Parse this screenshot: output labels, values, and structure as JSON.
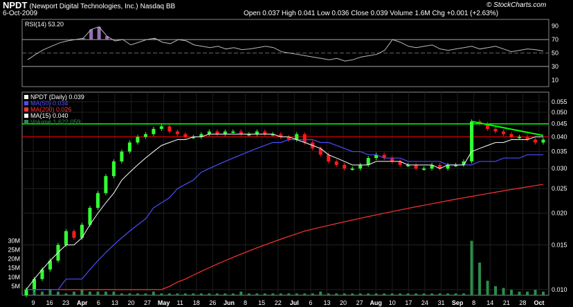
{
  "header": {
    "symbol": "NPDT",
    "company": "(Newport Digital Technologies, Inc.)",
    "exchange": "Nasdaq BB",
    "date": "6-Oct-2009",
    "ohlc": "Open 0.037  High 0.041  Low 0.036  Close 0.039  Volume 1.6M  Chg +0.001 (+2.63%)",
    "brand": "© StockCharts.com"
  },
  "colors": {
    "up": "#33ff33",
    "down": "#ff1a1a",
    "ma50": "#4d4dff",
    "ma200": "#ff3333",
    "ma15": "#ffffff",
    "volume": "#2d8a4e",
    "resistance": "#00ff00",
    "support": "#ff0000"
  },
  "chart_data": [
    {
      "type": "line",
      "title": "RSI(14) 53.20",
      "ylim": [
        0,
        100
      ],
      "y_ticks": [
        10,
        30,
        50,
        70,
        90
      ],
      "reference_lines": [
        30,
        70
      ],
      "last_value": 53.2,
      "series": [
        {
          "name": "RSI(14)",
          "values": [
            40,
            48,
            55,
            60,
            65,
            68,
            70,
            72,
            85,
            89,
            75,
            68,
            70,
            62,
            66,
            70,
            72,
            66,
            64,
            70,
            68,
            62,
            60,
            58,
            60,
            56,
            58,
            55,
            56,
            58,
            60,
            58,
            52,
            50,
            48,
            46,
            44,
            42,
            40,
            42,
            38,
            40,
            44,
            46,
            48,
            54,
            70,
            66,
            60,
            58,
            60,
            62,
            56,
            54,
            56,
            58,
            60,
            56,
            58,
            60,
            56,
            52,
            54,
            56,
            55,
            53
          ]
        }
      ]
    },
    {
      "type": "line",
      "title": "NPDT (Daily) 0.039",
      "y_ticks": [
        0.01,
        0.015,
        0.02,
        0.025,
        0.03,
        0.035,
        0.04,
        0.045,
        0.05,
        0.055
      ],
      "x_ticks": [
        "9",
        "16",
        "23",
        "Apr",
        "6",
        "13",
        "20",
        "27",
        "May",
        "11",
        "18",
        "26",
        "Jun",
        "8",
        "15",
        "22",
        "Jul",
        "6",
        "13",
        "20",
        "27",
        "Aug",
        "10",
        "17",
        "24",
        "31",
        "Sep",
        "8",
        "14",
        "21",
        "28",
        "Oct"
      ],
      "horizontal_lines": [
        0.045,
        0.04
      ],
      "legend": [
        "NPDT (Daily) 0.039",
        "MA(50) 0.034",
        "MA(200) 0.026",
        "MA(15) 0.040",
        "Volume 1,622,059"
      ],
      "close": [
        0.01,
        0.011,
        0.012,
        0.013,
        0.015,
        0.017,
        0.016,
        0.018,
        0.021,
        0.024,
        0.028,
        0.032,
        0.035,
        0.038,
        0.04,
        0.041,
        0.043,
        0.044,
        0.042,
        0.041,
        0.04,
        0.04,
        0.041,
        0.042,
        0.041,
        0.042,
        0.042,
        0.041,
        0.041,
        0.042,
        0.041,
        0.041,
        0.04,
        0.039,
        0.041,
        0.038,
        0.036,
        0.034,
        0.032,
        0.031,
        0.03,
        0.03,
        0.031,
        0.033,
        0.034,
        0.033,
        0.032,
        0.031,
        0.031,
        0.03,
        0.03,
        0.031,
        0.03,
        0.031,
        0.031,
        0.032,
        0.046,
        0.045,
        0.043,
        0.042,
        0.041,
        0.04,
        0.04,
        0.039,
        0.038,
        0.039
      ],
      "ma15": [
        0.01,
        0.011,
        0.012,
        0.013,
        0.014,
        0.015,
        0.015,
        0.016,
        0.018,
        0.02,
        0.022,
        0.024,
        0.027,
        0.029,
        0.031,
        0.033,
        0.035,
        0.037,
        0.038,
        0.039,
        0.039,
        0.04,
        0.04,
        0.041,
        0.041,
        0.041,
        0.041,
        0.041,
        0.041,
        0.041,
        0.041,
        0.041,
        0.04,
        0.04,
        0.039,
        0.038,
        0.037,
        0.036,
        0.034,
        0.033,
        0.032,
        0.031,
        0.031,
        0.031,
        0.032,
        0.032,
        0.032,
        0.032,
        0.031,
        0.031,
        0.031,
        0.031,
        0.03,
        0.031,
        0.031,
        0.031,
        0.035,
        0.036,
        0.037,
        0.038,
        0.038,
        0.039,
        0.039,
        0.039,
        0.04,
        0.04
      ],
      "ma50": [
        0.01,
        0.01,
        0.01,
        0.01,
        0.01,
        0.011,
        0.011,
        0.011,
        0.012,
        0.013,
        0.014,
        0.015,
        0.016,
        0.017,
        0.018,
        0.019,
        0.021,
        0.022,
        0.023,
        0.025,
        0.026,
        0.027,
        0.029,
        0.03,
        0.031,
        0.032,
        0.033,
        0.034,
        0.035,
        0.036,
        0.037,
        0.038,
        0.038,
        0.039,
        0.039,
        0.039,
        0.039,
        0.038,
        0.038,
        0.037,
        0.036,
        0.035,
        0.035,
        0.034,
        0.034,
        0.033,
        0.033,
        0.033,
        0.032,
        0.032,
        0.032,
        0.032,
        0.032,
        0.031,
        0.031,
        0.031,
        0.031,
        0.032,
        0.032,
        0.032,
        0.033,
        0.033,
        0.033,
        0.034,
        0.034,
        0.034
      ],
      "ma200": [
        0.01,
        0.01,
        0.01,
        0.01,
        0.01,
        0.01,
        0.01,
        0.01,
        0.01,
        0.01,
        0.01,
        0.01,
        0.01,
        0.01,
        0.01,
        0.01,
        0.01,
        0.01,
        0.0103,
        0.0107,
        0.011,
        0.0114,
        0.0118,
        0.0122,
        0.0126,
        0.013,
        0.0134,
        0.0138,
        0.0142,
        0.0146,
        0.015,
        0.0154,
        0.0158,
        0.0162,
        0.0166,
        0.017,
        0.0173,
        0.0176,
        0.0179,
        0.0182,
        0.0185,
        0.0188,
        0.0191,
        0.0194,
        0.0197,
        0.02,
        0.0203,
        0.0206,
        0.0209,
        0.0212,
        0.0215,
        0.0218,
        0.0221,
        0.0224,
        0.0227,
        0.023,
        0.0233,
        0.0236,
        0.0239,
        0.0242,
        0.0245,
        0.0248,
        0.0251,
        0.0254,
        0.0257,
        0.026
      ],
      "volume_ticks": [
        "5M",
        "10M",
        "15M",
        "20M",
        "25M",
        "30M"
      ],
      "volume_millions": [
        3,
        4,
        2,
        3,
        2,
        1,
        2,
        3,
        2,
        2,
        2,
        2,
        1,
        1,
        1,
        1,
        2,
        1,
        1,
        1,
        1,
        1,
        1,
        1,
        1,
        1,
        1,
        2,
        1,
        1,
        1,
        1,
        1,
        1,
        1,
        1,
        1,
        2,
        1,
        1,
        1,
        1,
        1,
        1,
        1,
        1,
        1,
        1,
        1,
        1,
        1,
        1,
        1,
        1,
        1,
        1,
        30,
        18,
        8,
        5,
        4,
        3,
        2,
        2,
        3,
        2
      ]
    }
  ]
}
